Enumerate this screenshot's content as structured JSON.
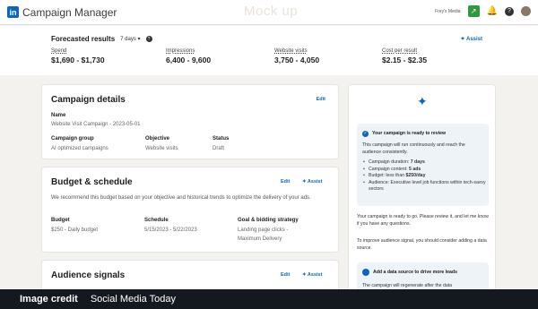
{
  "app": {
    "logo_text": "in",
    "title": "Campaign Manager",
    "watermark": "Mock up"
  },
  "topbar": {
    "account_name": "Frey's Media",
    "help_glyph": "?",
    "bell_glyph": "🔔",
    "flag_glyph": "↗"
  },
  "forecast": {
    "title": "Forecasted results",
    "days": "7 days ▾",
    "help_glyph": "?",
    "assist_label": "✦ Assist",
    "metrics": [
      {
        "label": "Spend",
        "value": "$1,690 - $1,730"
      },
      {
        "label": "Impressions",
        "value": "6,400 - 9,600"
      },
      {
        "label": "Website visits",
        "value": "3,750 - 4,050"
      },
      {
        "label": "Cost per result",
        "value": "$2.15 - $2.35"
      }
    ]
  },
  "campaign_details": {
    "title": "Campaign details",
    "edit_label": "Edit",
    "name_label": "Name",
    "name_value": "Website Visit Campaign - 2023-05-01",
    "group_label": "Campaign group",
    "group_value": "AI optimized campaigns",
    "objective_label": "Objective",
    "objective_value": "Website visits",
    "status_label": "Status",
    "status_value": "Draft"
  },
  "budget": {
    "title": "Budget & schedule",
    "edit_label": "Edit",
    "assist_label": "✦ Assist",
    "description": "We recommend this budget based on your objective and historical trends to optimize the delivery of your ads.",
    "budget_label": "Budget",
    "budget_value": "$250 - Daily budget",
    "schedule_label": "Schedule",
    "schedule_value": "5/15/2023 - 5/22/2023",
    "goal_label": "Goal & bidding strategy",
    "goal_value_1": "Landing page clicks -",
    "goal_value_2": "Maximum Delivery"
  },
  "audience": {
    "title": "Audience signals",
    "edit_label": "Edit",
    "assist_label": "✦ Assist"
  },
  "assistant": {
    "sparkle": "✦",
    "review_title": "Your campaign is ready to review",
    "review_text": "This campaign will run continuously and reach the audience consistently.",
    "bullets": [
      {
        "label": "Campaign duration: ",
        "value": "7 days"
      },
      {
        "label": "Campaign content: ",
        "value": "5 ads"
      },
      {
        "label": "Budget: less than ",
        "value": "$250/day"
      },
      {
        "label": "Audience: Executive level job functions within tech-savvy sectors",
        "value": ""
      }
    ],
    "message_1": "Your campaign is ready to go. Please review it, and let me know if you have any questions.",
    "message_2": "To improve audience signal, you should consider adding a data source.",
    "data_title": "Add a data source to drive more leads",
    "data_text": "The campaign will regenerate after the data"
  },
  "credit": {
    "label": "Image credit",
    "source": "Social Media Today"
  },
  "colors": {
    "brand": "#0a66c2",
    "background": "#f3f2ef",
    "credit_bar": "#14181f"
  }
}
